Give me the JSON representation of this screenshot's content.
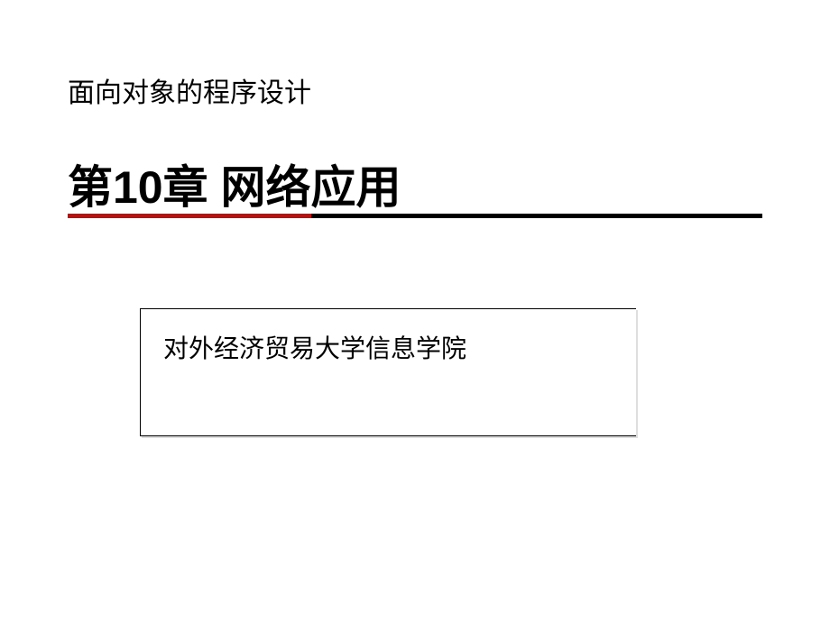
{
  "slide": {
    "courseTitle": "面向对象的程序设计",
    "chapterTitle": "第10章 网络应用",
    "institution": "对外经济贸易大学信息学院"
  },
  "colors": {
    "accentRed": "#b01513",
    "text": "#000000"
  }
}
